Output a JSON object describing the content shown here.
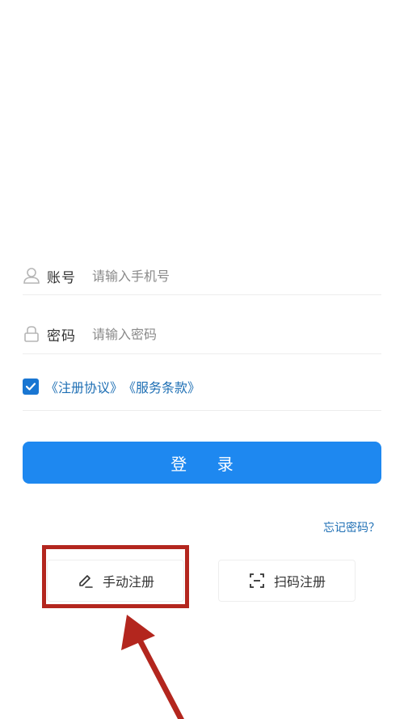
{
  "login_form": {
    "account": {
      "label": "账号",
      "placeholder": "请输入手机号",
      "icon": "user-icon"
    },
    "password": {
      "label": "密码",
      "placeholder": "请输入密码",
      "icon": "lock-icon"
    },
    "agreement": {
      "checked": true,
      "register_agreement": "《注册协议》",
      "service_terms": "《服务条款》"
    },
    "login_button": "登 录",
    "forgot_password": "忘记密码？"
  },
  "register_options": {
    "manual": {
      "label": "手动注册",
      "icon": "pencil-icon"
    },
    "scan": {
      "label": "扫码注册",
      "icon": "scan-icon"
    }
  },
  "colors": {
    "primary": "#1e88f0",
    "link": "#1e6fb4",
    "annotation": "#b3261e"
  }
}
